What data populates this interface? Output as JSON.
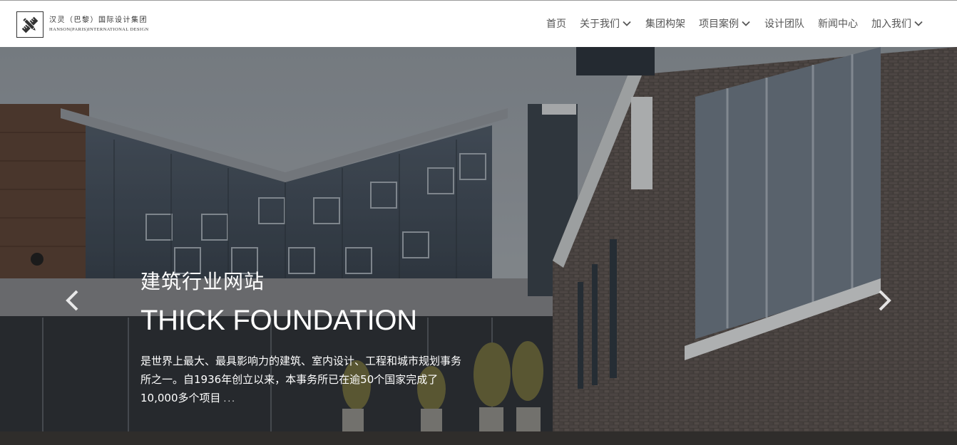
{
  "brand": {
    "name_cn": "汉灵（巴黎）国际设计集团",
    "name_en": "HANSON(PARIS)INTERNATIONAL DESIGN",
    "logo_icon": "pencil-ruler-icon"
  },
  "nav": {
    "items": [
      {
        "label": "首页",
        "dropdown": false
      },
      {
        "label": "关于我们",
        "dropdown": true
      },
      {
        "label": "集团构架",
        "dropdown": false
      },
      {
        "label": "项目案例",
        "dropdown": true
      },
      {
        "label": "设计团队",
        "dropdown": false
      },
      {
        "label": "新闻中心",
        "dropdown": false
      },
      {
        "label": "加入我们",
        "dropdown": true
      }
    ],
    "dropdown_icon": "chevron-down-icon"
  },
  "hero": {
    "title_cn": "建筑行业网站",
    "title_en": "THICK FOUNDATION",
    "description": "是世界上最大、最具影响力的建筑、室内设计、工程和城市规划事务所之一。自1936年创立以来，本事务所已在逾50个国家完成了10,000多个项目",
    "more": "...",
    "prev_icon": "chevron-left-icon",
    "next_icon": "chevron-right-icon"
  },
  "colors": {
    "nav_text": "#555555",
    "header_bg": "#ffffff",
    "hero_text": "#ffffff"
  }
}
